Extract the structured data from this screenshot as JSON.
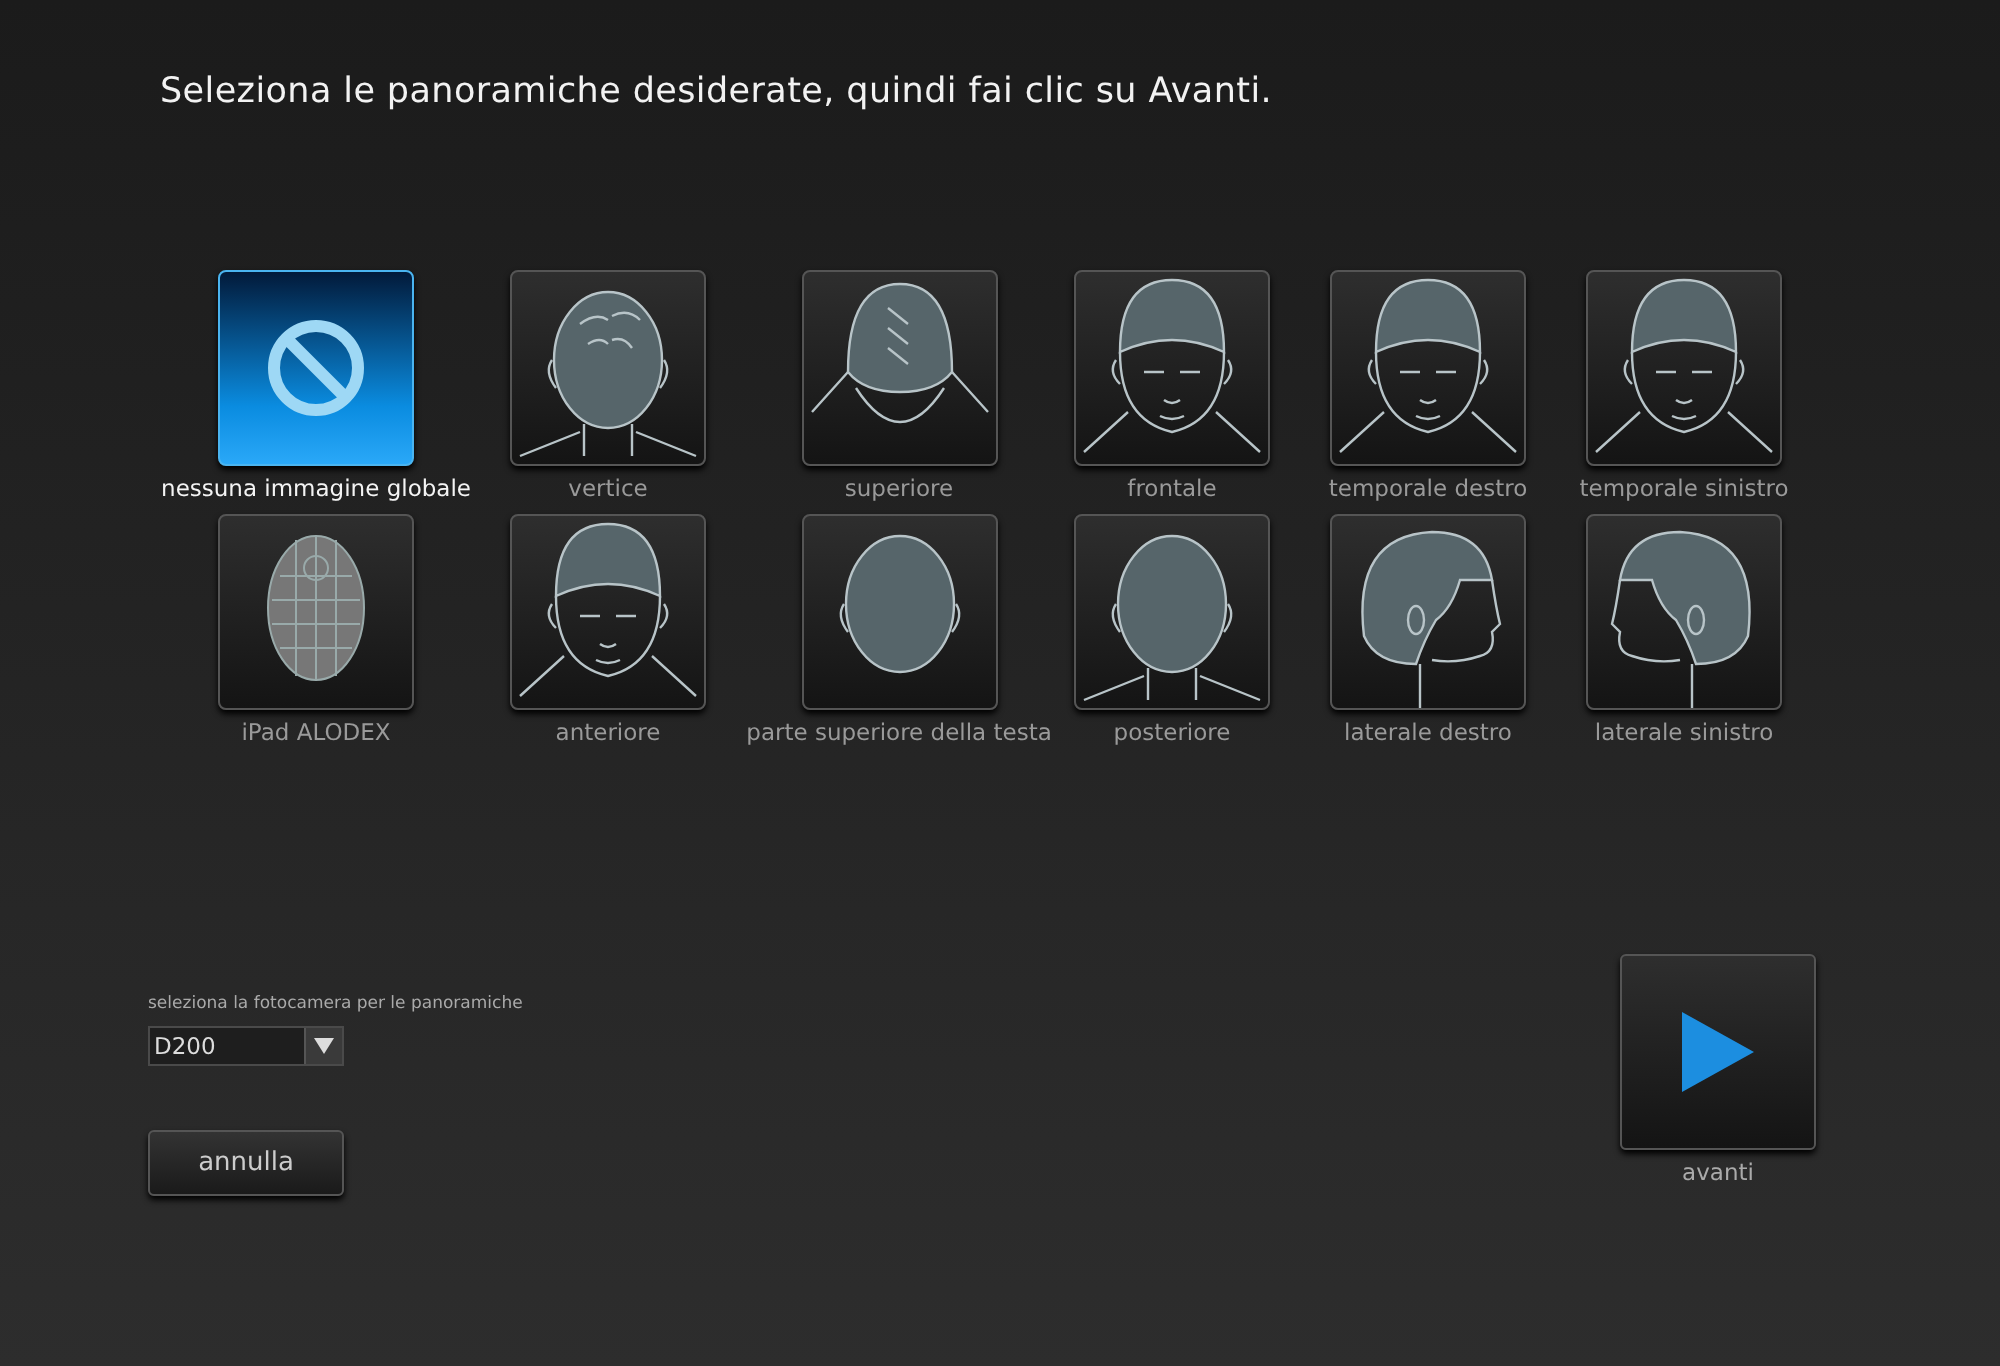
{
  "heading": "Seleziona le panoramiche desiderate, quindi fai clic su Avanti.",
  "views": [
    {
      "label": "nessuna immagine globale",
      "kind": "none",
      "selected": true
    },
    {
      "label": "vertice",
      "kind": "back-top",
      "selected": false
    },
    {
      "label": "superiore",
      "kind": "crown",
      "selected": false
    },
    {
      "label": "frontale",
      "kind": "front-down",
      "selected": false
    },
    {
      "label": "temporale destro",
      "kind": "temple-right",
      "selected": false
    },
    {
      "label": "temporale sinistro",
      "kind": "temple-left",
      "selected": false
    },
    {
      "label": "iPad ALODEX",
      "kind": "grid-head",
      "selected": false
    },
    {
      "label": "anteriore",
      "kind": "front",
      "selected": false
    },
    {
      "label": "parte superiore della testa",
      "kind": "top",
      "selected": false
    },
    {
      "label": "posteriore",
      "kind": "back",
      "selected": false
    },
    {
      "label": "laterale destro",
      "kind": "side-right",
      "selected": false
    },
    {
      "label": "laterale sinistro",
      "kind": "side-left",
      "selected": false
    }
  ],
  "camera": {
    "label": "seleziona la fotocamera per le panoramiche",
    "value": "D200"
  },
  "cancel_button": "annulla",
  "next_button": "avanti"
}
